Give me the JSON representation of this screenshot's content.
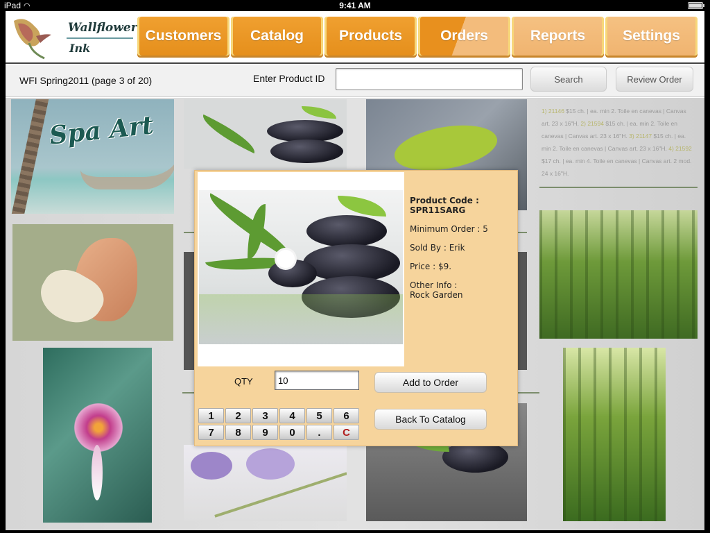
{
  "status_bar": {
    "device": "iPad",
    "time": "9:41 AM",
    "wifi_icon": "wifi-icon",
    "battery_icon": "battery-icon"
  },
  "header": {
    "logo": {
      "line1": "Wallflower",
      "line2": "Ink",
      "icon": "calla-lily-logo"
    },
    "tabs": [
      {
        "label": "Customers"
      },
      {
        "label": "Catalog"
      },
      {
        "label": "Products"
      },
      {
        "label": "Orders"
      },
      {
        "label": "Reports"
      },
      {
        "label": "Settings"
      }
    ],
    "accent_color": "#E8901E"
  },
  "toolbar": {
    "catalog_title": "WFI Spring2011 (page 3 of 20)",
    "product_id_label": "Enter Product ID",
    "product_id_value": "",
    "search_label": "Search",
    "review_order_label": "Review Order"
  },
  "catalog": {
    "spa_title": "Spa Art",
    "description": {
      "items": [
        {
          "code": "1) 21146",
          "text": " $15 ch. | ea. min 2. Toile en canevas | Canvas art. 23 x 16\"H."
        },
        {
          "code": "2) 21594",
          "text": " $15 ch. | ea. min 2. Toile en canevas | Canvas art. 23 x 16\"H."
        },
        {
          "code": "3) 21147",
          "text": " $15 ch. | ea. min 2. Toile en canevas | Canvas art. 23 x 16\"H."
        },
        {
          "code": "4) 21592",
          "text": " $17 ch. | ea. min 4. Toile en canevas | Canvas art. 2 mod. 24 x 16\"H."
        }
      ]
    }
  },
  "product_dialog": {
    "product_code_label": "Product Code :",
    "product_code": "SPR11SARG",
    "minimum_order": "Minimum Order : 5",
    "sold_by": "Sold By : Erik",
    "price": "Price :  $9.",
    "other_info_label": "Other Info :",
    "other_info": "Rock  Garden",
    "qty_label": "QTY",
    "qty_value": "10",
    "add_to_order_label": "Add to Order",
    "back_to_catalog_label": "Back To Catalog",
    "keypad": [
      "1",
      "2",
      "3",
      "4",
      "5",
      "6",
      "7",
      "8",
      "9",
      "0",
      ".",
      "C"
    ],
    "clear_key_color": "#B01C1C"
  }
}
